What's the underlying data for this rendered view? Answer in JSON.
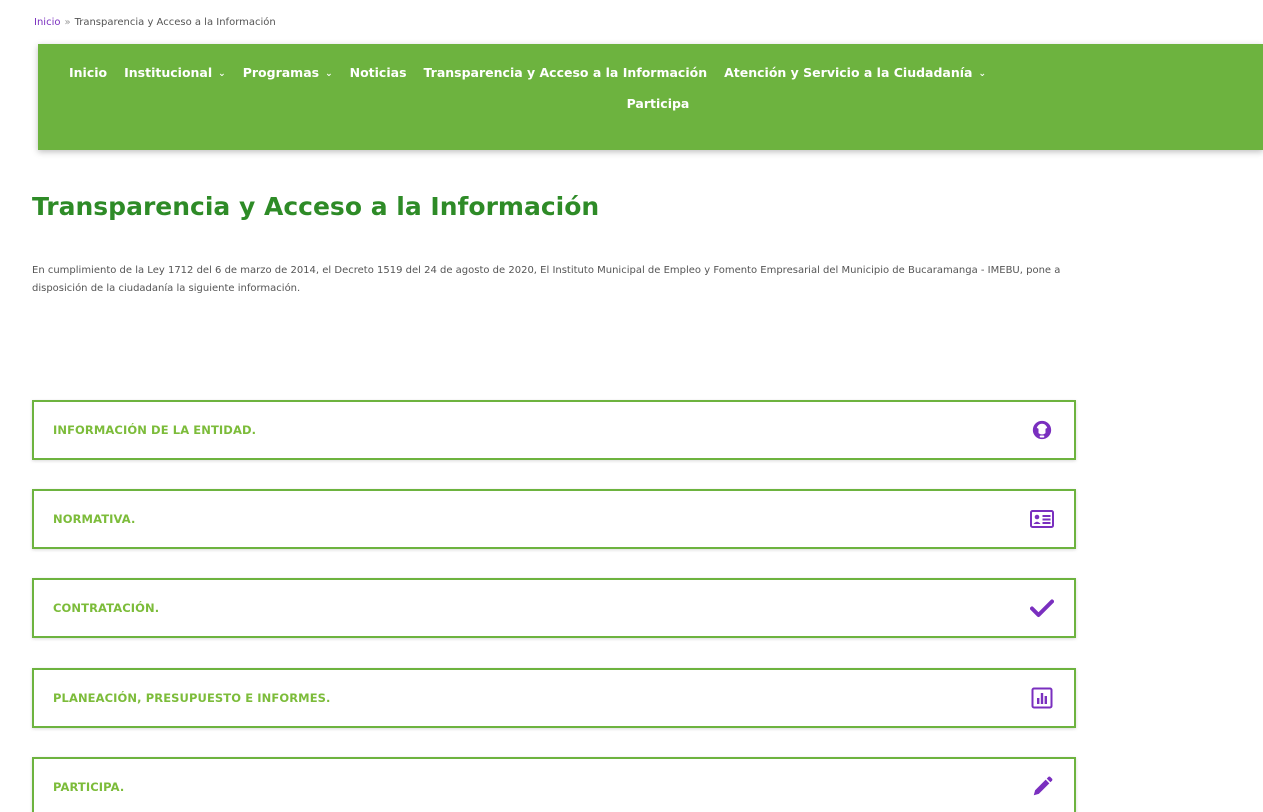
{
  "breadcrumb": {
    "home": "Inicio",
    "separator": "»",
    "current": "Transparencia y Acceso a la Información"
  },
  "nav": {
    "items": [
      {
        "label": "Inicio",
        "dropdown": false
      },
      {
        "label": "Institucional",
        "dropdown": true
      },
      {
        "label": "Programas",
        "dropdown": true
      },
      {
        "label": "Noticias",
        "dropdown": false
      },
      {
        "label": "Transparencia y Acceso a la Información",
        "dropdown": false
      },
      {
        "label": "Atención y Servicio a la Ciudadanía",
        "dropdown": true
      },
      {
        "label": "Participa",
        "dropdown": false
      }
    ],
    "caret": "⌄"
  },
  "main": {
    "title": "Transparencia y Acceso a la Información",
    "intro": "En cumplimiento de la Ley 1712 del 6 de marzo de 2014, el Decreto 1519 del 24 de agosto de 2020, El Instituto Municipal de Empleo y Fomento Empresarial del Municipio de Bucaramanga - IMEBU, pone a disposición de la ciudadanía la siguiente información.",
    "sections": [
      {
        "label": "INFORMACIÓN DE LA ENTIDAD.",
        "icon": "headset-icon"
      },
      {
        "label": "NORMATIVA.",
        "icon": "id-card-icon"
      },
      {
        "label": "CONTRATACIÓN.",
        "icon": "check-icon"
      },
      {
        "label": "PLANEACIÓN, PRESUPUESTO E INFORMES.",
        "icon": "bar-chart-icon"
      },
      {
        "label": "PARTICIPA.",
        "icon": "pencil-icon"
      }
    ]
  },
  "colors": {
    "brand_green": "#6db33f",
    "title_green": "#2e8b27",
    "label_green": "#7cbc3a",
    "icon_purple": "#7a2fbf"
  }
}
